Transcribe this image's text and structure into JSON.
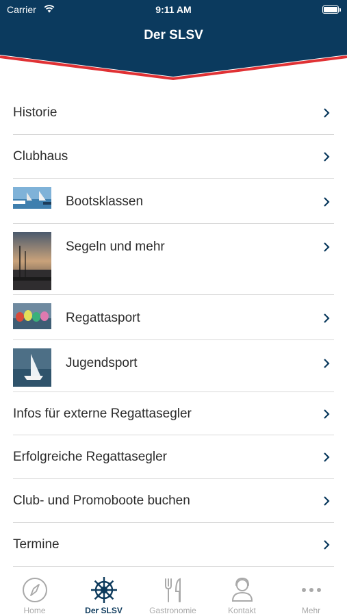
{
  "status_bar": {
    "carrier": "Carrier",
    "time": "9:11 AM"
  },
  "header": {
    "title": "Der SLSV"
  },
  "colors": {
    "navy": "#0b3a5e",
    "red": "#e03134",
    "tab_inactive": "#a9a9a9"
  },
  "menu": [
    {
      "label": "Historie"
    },
    {
      "label": "Clubhaus"
    },
    {
      "label": "Bootsklassen",
      "thumbnail": "sailboats-photo"
    },
    {
      "label": "Segeln und mehr",
      "thumbnail": "sunset-harbor-photo"
    },
    {
      "label": "Regattasport",
      "thumbnail": "regatta-spinnakers-photo"
    },
    {
      "label": "Jugendsport",
      "thumbnail": "youth-dinghy-photo"
    },
    {
      "label": "Infos für externe Regattasegler"
    },
    {
      "label": "Erfolgreiche Regattasegler"
    },
    {
      "label": "Club- und Promoboote buchen"
    },
    {
      "label": "Termine"
    }
  ],
  "tabbar": {
    "items": [
      {
        "label": "Home",
        "icon": "compass-icon"
      },
      {
        "label": "Der SLSV",
        "icon": "ship-wheel-icon",
        "selected": true
      },
      {
        "label": "Gastronomie",
        "icon": "fork-knife-icon"
      },
      {
        "label": "Kontakt",
        "icon": "contact-person-icon"
      },
      {
        "label": "Mehr",
        "icon": "more-dots-icon"
      }
    ]
  }
}
